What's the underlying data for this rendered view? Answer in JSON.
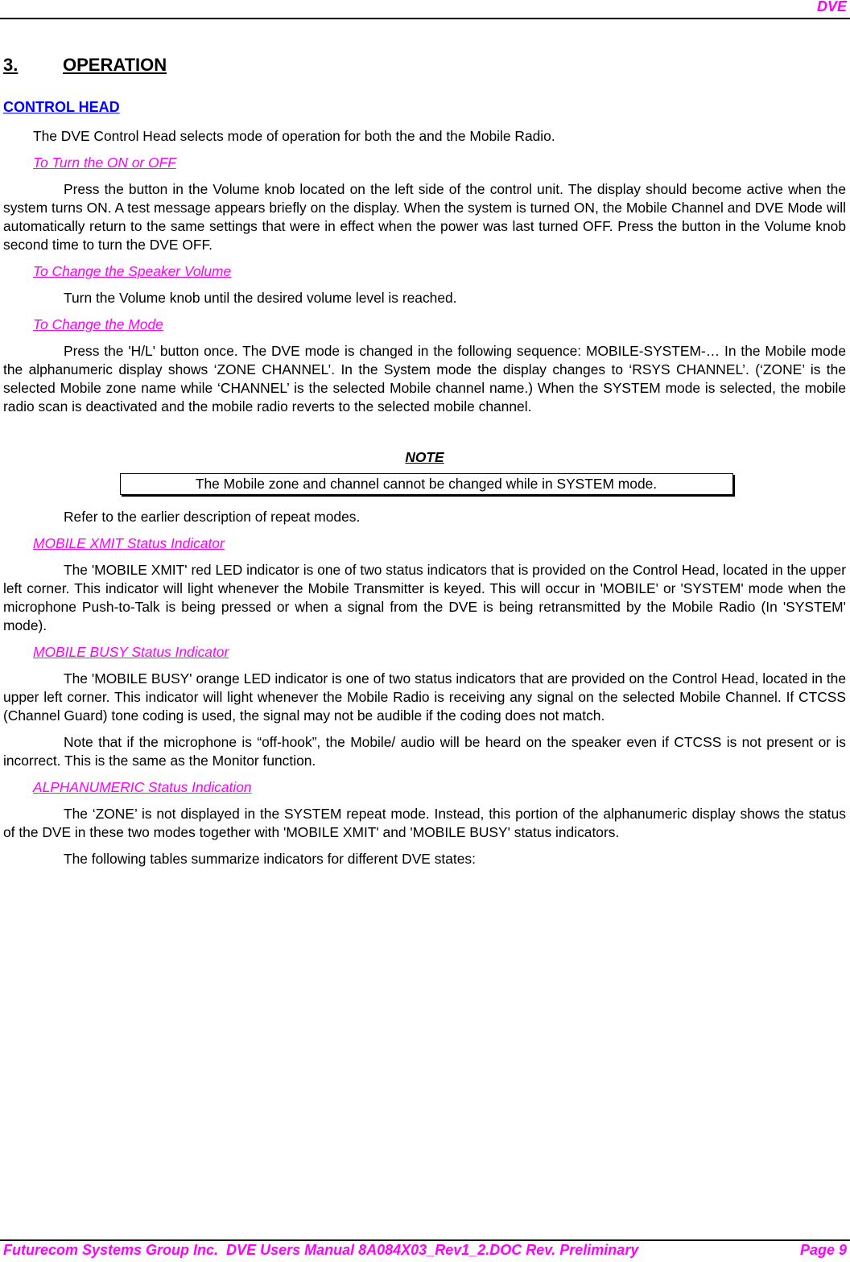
{
  "header": {
    "title": "DVE"
  },
  "chapter": {
    "number": "3.",
    "title": "OPERATION"
  },
  "section": {
    "title": "CONTROL HEAD"
  },
  "intro": "The DVE Control Head selects mode of operation for both the  and the Mobile Radio.",
  "subsections": [
    {
      "heading": "To Turn the  ON or OFF",
      "paragraphs": [
        "Press the button in the Volume knob located on the left side of the control unit. The display should become active when the system turns ON. A test message appears briefly on the display. When the system is turned ON, the Mobile Channel and DVE Mode will automatically return to the same settings that were in effect when the power was last turned OFF. Press the button in the Volume knob second time to turn the DVE OFF."
      ]
    },
    {
      "heading": "To Change the Speaker Volume",
      "paragraphs": [
        "Turn the Volume knob until the desired volume level is reached."
      ]
    },
    {
      "heading": "To Change the  Mode",
      "paragraphs": [
        "Press the 'H/L' button once. The DVE mode is changed in the following sequence: MOBILE-SYSTEM-… In the Mobile mode the alphanumeric display shows ‘ZONE CHANNEL’. In the System mode the display changes to ‘RSYS CHANNEL’. (‘ZONE’ is the selected Mobile zone name while ‘CHANNEL’ is the selected Mobile channel name.) When the SYSTEM mode is selected, the mobile radio scan is deactivated and the mobile radio reverts to the selected mobile channel."
      ]
    }
  ],
  "note": {
    "title": "NOTE",
    "text": "The Mobile zone and channel cannot be changed while in SYSTEM mode."
  },
  "after_note": "Refer to the earlier description of repeat modes.",
  "subsections2": [
    {
      "heading": "MOBILE XMIT Status Indicator",
      "paragraphs": [
        "The 'MOBILE XMIT' red LED indicator is one of two status indicators that is provided on the Control Head, located in the upper left corner. This indicator will light whenever the Mobile Transmitter is keyed. This will occur in 'MOBILE' or 'SYSTEM' mode when the microphone Push-to-Talk is being pressed or when a signal from the DVE is being retransmitted by the Mobile Radio (In 'SYSTEM' mode)."
      ]
    },
    {
      "heading": "MOBILE BUSY Status Indicator",
      "paragraphs": [
        "The 'MOBILE BUSY' orange LED indicator is one of two status indicators that are provided on the Control Head, located in the upper left corner. This indicator will light whenever the Mobile Radio is receiving any signal on the selected Mobile Channel. If CTCSS (Channel Guard) tone coding is used, the signal may not be audible if the coding does not match.",
        "Note that if the microphone is “off-hook”, the Mobile/ audio will be heard on the speaker even if CTCSS is not present or is incorrect. This is the same as the Monitor function."
      ]
    },
    {
      "heading": "ALPHANUMERIC Status Indication",
      "paragraphs": [
        "The ‘ZONE’ is not displayed in the SYSTEM repeat mode. Instead, this portion of the alphanumeric display shows the status of the DVE in these two modes together with 'MOBILE XMIT' and 'MOBILE BUSY' status indicators.",
        "The following tables summarize indicators for different DVE states:"
      ]
    }
  ],
  "footer": {
    "left": "Futurecom Systems Group Inc.  DVE Users Manual 8A084X03_Rev1_2.DOC Rev. Preliminary",
    "right": "Page 9"
  }
}
